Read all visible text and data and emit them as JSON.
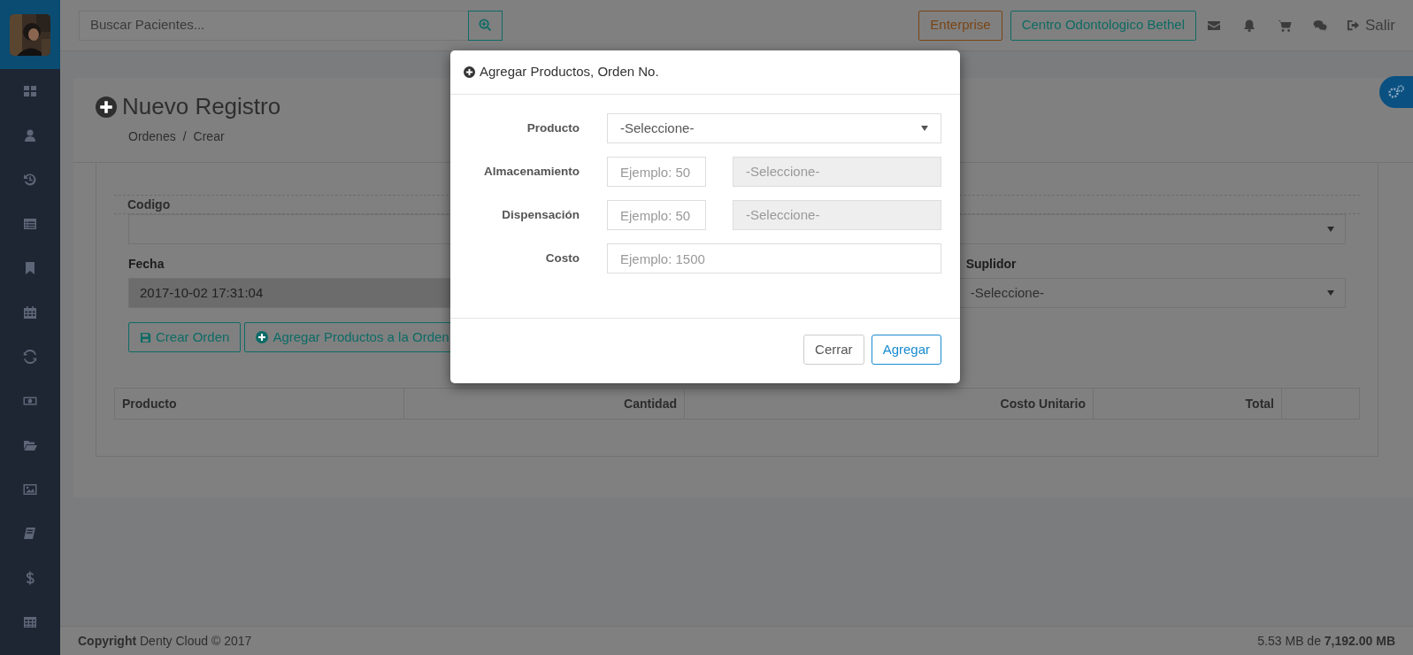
{
  "topbar": {
    "search": {
      "placeholder": "Buscar Pacientes..."
    },
    "badges": [
      {
        "label": "Enterprise",
        "color": "#7a4514"
      },
      {
        "label": "Centro Odontologico Bethel",
        "color": "#0e6b62"
      }
    ],
    "logout": "Salir"
  },
  "page": {
    "title": "Nuevo Registro",
    "breadcrumb": {
      "items": [
        "Ordenes",
        "Crear"
      ],
      "divider": "/"
    },
    "fields": [
      {
        "label": "Codigo",
        "kind": "select",
        "disabled": false
      },
      {
        "label": "Fecha",
        "kind": "input",
        "value": "2017-10-02 17:31:04",
        "disabled": true
      },
      {
        "label": "Suplidor",
        "kind": "select",
        "value": "-Seleccione-",
        "disabled": false
      }
    ],
    "buttons": [
      {
        "label": "Crear Orden",
        "kind": "save"
      },
      {
        "label": "Agregar Productos a la Orden",
        "kind": "add"
      }
    ],
    "table": {
      "columns": [
        "Producto",
        "Cantidad",
        "Costo Unitario",
        "Total"
      ]
    }
  },
  "footer": {
    "copyright": "**Copyright** Denty Cloud © 2017",
    "storage": "5.53 MB de **7,192.00 MB**"
  },
  "modal": {
    "title": "Agregar Productos, Orden No.",
    "rows": [
      {
        "label": "Producto",
        "controls": [
          {
            "kind": "select",
            "value": "-Seleccione-",
            "disabled": false
          }
        ]
      },
      {
        "label": "Almacenamiento",
        "controls": [
          {
            "kind": "input",
            "placeholder": "Ejemplo: 50"
          },
          {
            "kind": "select",
            "value": "-Seleccione-",
            "disabled": true
          }
        ]
      },
      {
        "label": "Dispensación",
        "controls": [
          {
            "kind": "input",
            "placeholder": "Ejemplo: 50"
          },
          {
            "kind": "select",
            "value": "-Seleccione-",
            "disabled": true
          }
        ]
      },
      {
        "label": "Costo",
        "controls": [
          {
            "kind": "input",
            "placeholder": "Ejemplo: 1500"
          }
        ]
      }
    ],
    "buttons": [
      {
        "label": "Cerrar",
        "kind": "secondary"
      },
      {
        "label": "Agregar",
        "kind": "primary"
      }
    ]
  }
}
